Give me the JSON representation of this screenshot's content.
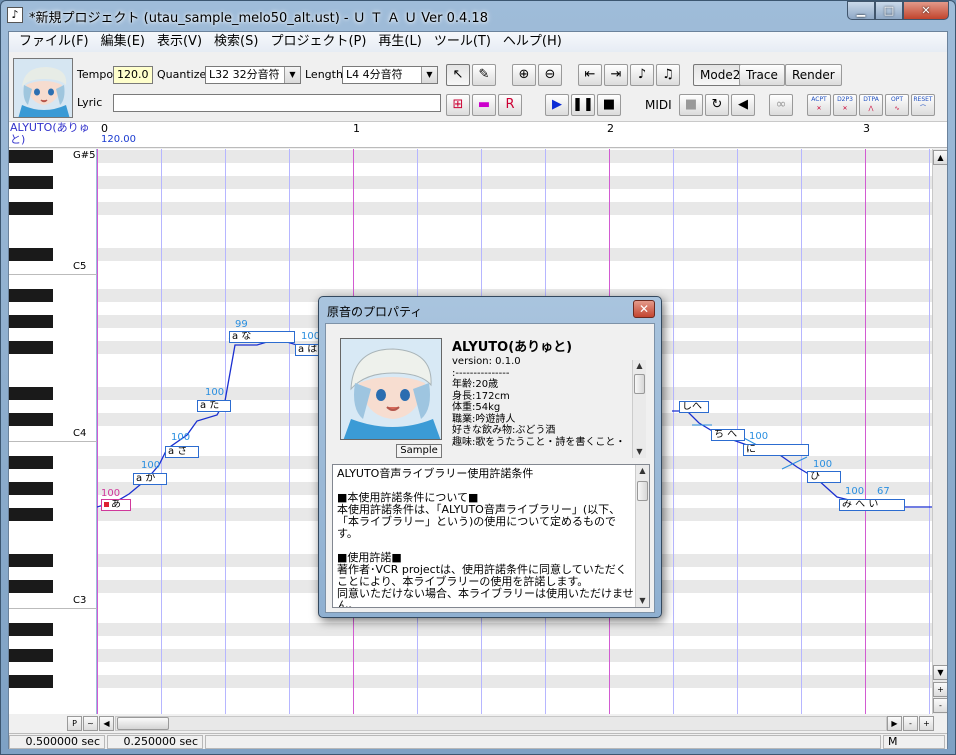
{
  "window": {
    "title": "*新規プロジェクト (utau_sample_melo50_alt.ust) - Ｕ Ｔ Ａ Ｕ Ver 0.4.18",
    "minimize": "▁",
    "maximize": "□",
    "close": "✕",
    "app_icon": "♪"
  },
  "menu": [
    "ファイル(F)",
    "編集(E)",
    "表示(V)",
    "検索(S)",
    "プロジェクト(P)",
    "再生(L)",
    "ツール(T)",
    "ヘルプ(H)"
  ],
  "toolbar": {
    "tempo_label": "Tempo",
    "tempo_value": "120.0",
    "quantize_label": "Quantize",
    "quantize_value": "L32 32分音符",
    "length_label": "Length",
    "length_value": "L4  4分音符",
    "lyric_label": "Lyric",
    "lyric_value": "",
    "mode2": "Mode2",
    "trace": "Trace",
    "render": "Render",
    "midi": "MIDI",
    "plugins": [
      "ACPT",
      "D2P3",
      "DTPA",
      "OPT",
      "RESET"
    ]
  },
  "ruler": {
    "singer": "ALYUTO(ありゅと)",
    "measures": [
      "0",
      "1",
      "2",
      "3"
    ],
    "tempo_marker": "120.00"
  },
  "piano": {
    "labels": [
      "G#5",
      "C5",
      "C4",
      "C3"
    ]
  },
  "notes": [
    {
      "lyric": "あ",
      "vel": "100"
    },
    {
      "lyric": "a か",
      "vel": "100"
    },
    {
      "lyric": "a さ",
      "vel": "100"
    },
    {
      "lyric": "a た",
      "vel": "100"
    },
    {
      "lyric": "a な",
      "vel": "99"
    },
    {
      "lyric": "a は",
      "vel": "100"
    },
    {
      "lyric": "しへ",
      "vel": ""
    },
    {
      "lyric": "ち へ",
      "vel": ""
    },
    {
      "lyric": "に",
      "vel": "100"
    },
    {
      "lyric": "ひ",
      "vel": "100"
    },
    {
      "lyric": "み へ い",
      "vel": "100"
    },
    {
      "lyric": "",
      "vel": "67"
    }
  ],
  "status": {
    "left": "0.500000 sec",
    "mid": "0.250000 sec",
    "right": "M"
  },
  "hscroll": {
    "p": "P",
    "tilde": "~"
  },
  "dialog": {
    "title": "原音のプロパティ",
    "close": "✕",
    "voicebank_name": "ALYUTO(ありゅと)",
    "sample_button": "Sample",
    "info_lines": [
      "version: 0.1.0",
      ":---------------",
      "年齢:20歳",
      "身長:172cm",
      "体重:54kg",
      "職業:吟遊詩人",
      "好きな飲み物:ぶどう酒",
      "趣味:歌をうたうこと・詩を書くこと・"
    ],
    "license_lines": [
      "ALYUTO音声ライブラリー使用許諾条件",
      "",
      "■本使用許諾条件について■",
      "本使用許諾条件は、「ALYUTO音声ライブラリー」(以下、「本ライブラリー」という)の使用について定めるものです。",
      "",
      "■使用許諾■",
      "著作者･VCR projectは、使用許諾条件に同意していただくことにより、本ライブラリーの使用を許諾します。",
      "同意いただけない場合、本ライブラリーは使用いただけません。"
    ]
  }
}
